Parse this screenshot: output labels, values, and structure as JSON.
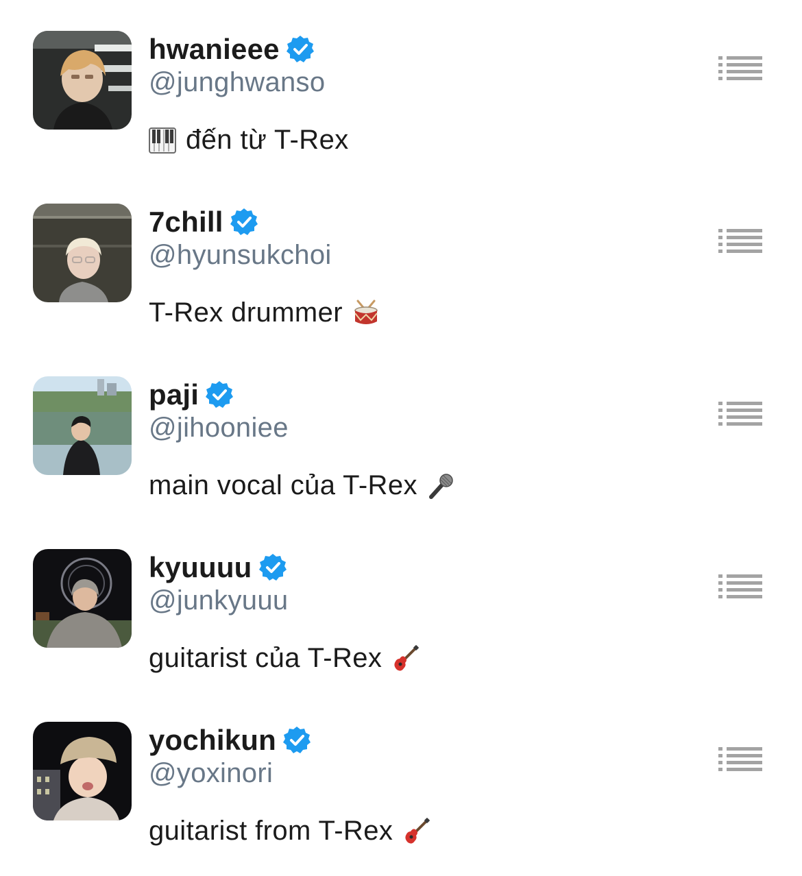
{
  "accounts": [
    {
      "display_name": "hwanieee",
      "handle": "@junghwanso",
      "bio_text": "đến từ T-Rex",
      "bio_emoji": "piano-emoji",
      "bio_emoji_position": "leading",
      "verified": true
    },
    {
      "display_name": "7chill",
      "handle": "@hyunsukchoi",
      "bio_text": "T-Rex drummer",
      "bio_emoji": "drum-emoji",
      "bio_emoji_position": "trailing",
      "verified": true
    },
    {
      "display_name": "paji",
      "handle": "@jihooniee",
      "bio_text": "main vocal của T-Rex",
      "bio_emoji": "microphone-emoji",
      "bio_emoji_position": "trailing",
      "verified": true
    },
    {
      "display_name": "kyuuuu",
      "handle": "@junkyuuu",
      "bio_text": "guitarist của T-Rex",
      "bio_emoji": "guitar-emoji",
      "bio_emoji_position": "trailing",
      "verified": true
    },
    {
      "display_name": "yochikun",
      "handle": "@yoxinori",
      "bio_text": "guitarist from T-Rex",
      "bio_emoji": "guitar-emoji",
      "bio_emoji_position": "trailing",
      "verified": true
    }
  ],
  "icons": {
    "verified_badge": "verified-check-icon",
    "row_action": "list-icon"
  },
  "colors": {
    "name_text": "#1b1b1b",
    "handle_text": "#687787",
    "verified_blue": "#1d9bf0",
    "list_icon_gray": "#a3a3a3"
  }
}
